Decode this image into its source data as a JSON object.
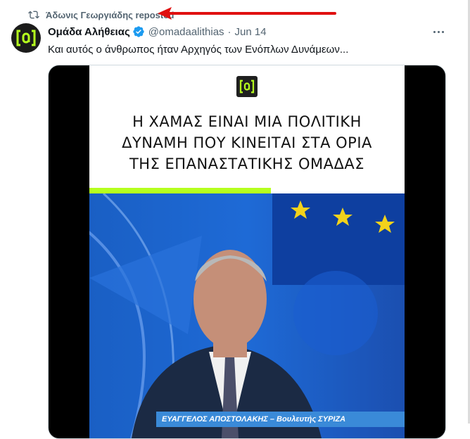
{
  "repost": {
    "icon": "repost-icon",
    "label": "Άδωνις Γεωργιάδης reposted"
  },
  "author": {
    "display_name": "Ομάδα Αλήθειας",
    "verified": true,
    "handle": "@omadaalithias",
    "separator": "·",
    "date": "Jun 14"
  },
  "tweet": {
    "text": "Και αυτός ο άνθρωπος ήταν Αρχηγός των Ενόπλων Δυνάμεων..."
  },
  "media": {
    "logo_text": "[a]",
    "headline_lines": [
      "Η ΧΑΜΑΣ ΕΙΝΑΙ ΜΙΑ ΠΟΛΙΤΙΚΗ",
      "ΔΥΝΑΜΗ ΠΟΥ ΚΙΝΕΙΤΑΙ ΣΤΑ ΟΡΙΑ",
      "ΤΗΣ ΕΠΑΝΑΣΤΑΤΙΚΗΣ ΟΜΑΔΑΣ"
    ],
    "caption": "ΕΥΑΓΓΕΛΟΣ ΑΠΟΣΤΟΛΑΚΗΣ – Βουλευτής ΣΥΡΙΖΑ"
  },
  "colors": {
    "accent_green": "#b5ff1e",
    "verified_blue": "#1d9bf0",
    "annotation_red": "#e01010"
  }
}
